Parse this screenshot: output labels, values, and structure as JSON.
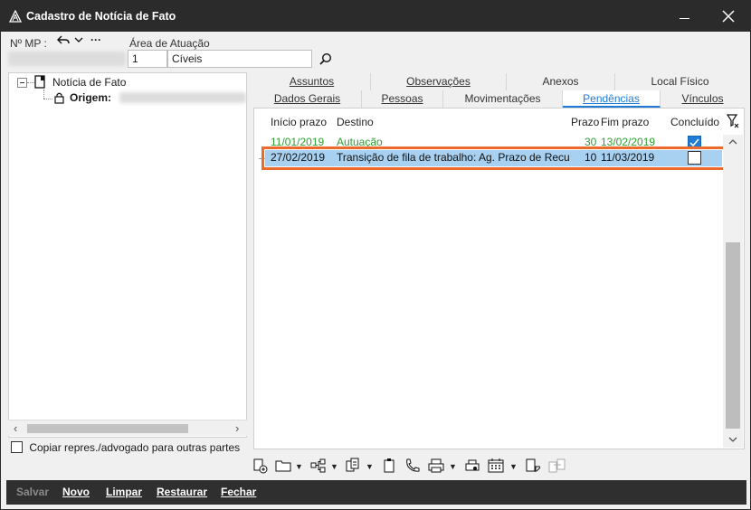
{
  "window": {
    "title": "Cadastro de Notícia de Fato"
  },
  "header": {
    "mp_label": "Nº MP :",
    "area_label": "Área de Atuação",
    "area_code": "1",
    "area_name": "Cíveis"
  },
  "tree": {
    "root_label": "Notícia de Fato",
    "child_label": "Origem:"
  },
  "copy_checkbox_label": "Copiar repres./advogado para outras partes",
  "tabs_row1": [
    {
      "label": "Assuntos"
    },
    {
      "label": "Observações"
    },
    {
      "label": "Anexos"
    },
    {
      "label": "Local Físico"
    }
  ],
  "tabs_row2": [
    {
      "label": "Dados Gerais"
    },
    {
      "label": "Pessoas"
    },
    {
      "label": "Movimentações"
    },
    {
      "label": "Pendências"
    },
    {
      "label": "Vínculos"
    }
  ],
  "grid": {
    "columns": {
      "inicio": "Início prazo",
      "destino": "Destino",
      "prazo": "Prazo",
      "fim": "Fim prazo",
      "concluido": "Concluído"
    },
    "rows": [
      {
        "inicio": "11/01/2019",
        "destino": "Autuação",
        "prazo": "30",
        "fim": "13/02/2019",
        "concluido": true
      },
      {
        "inicio": "27/02/2019",
        "destino": "Transição de fila de trabalho: Ag. Prazo de Recu",
        "prazo": "10",
        "fim": "11/03/2019",
        "concluido": false
      }
    ],
    "row_marker": "→"
  },
  "commands": {
    "salvar": "Salvar",
    "novo": "Novo",
    "limpar": "Limpar",
    "restaurar": "Restaurar",
    "fechar": "Fechar"
  },
  "colors": {
    "titlebar": "#2b2b2b",
    "accent": "#1e7bd6",
    "selection_outline": "#ec6a2b",
    "selected_row": "#a8d0f0",
    "green_text": "#2ea031"
  }
}
